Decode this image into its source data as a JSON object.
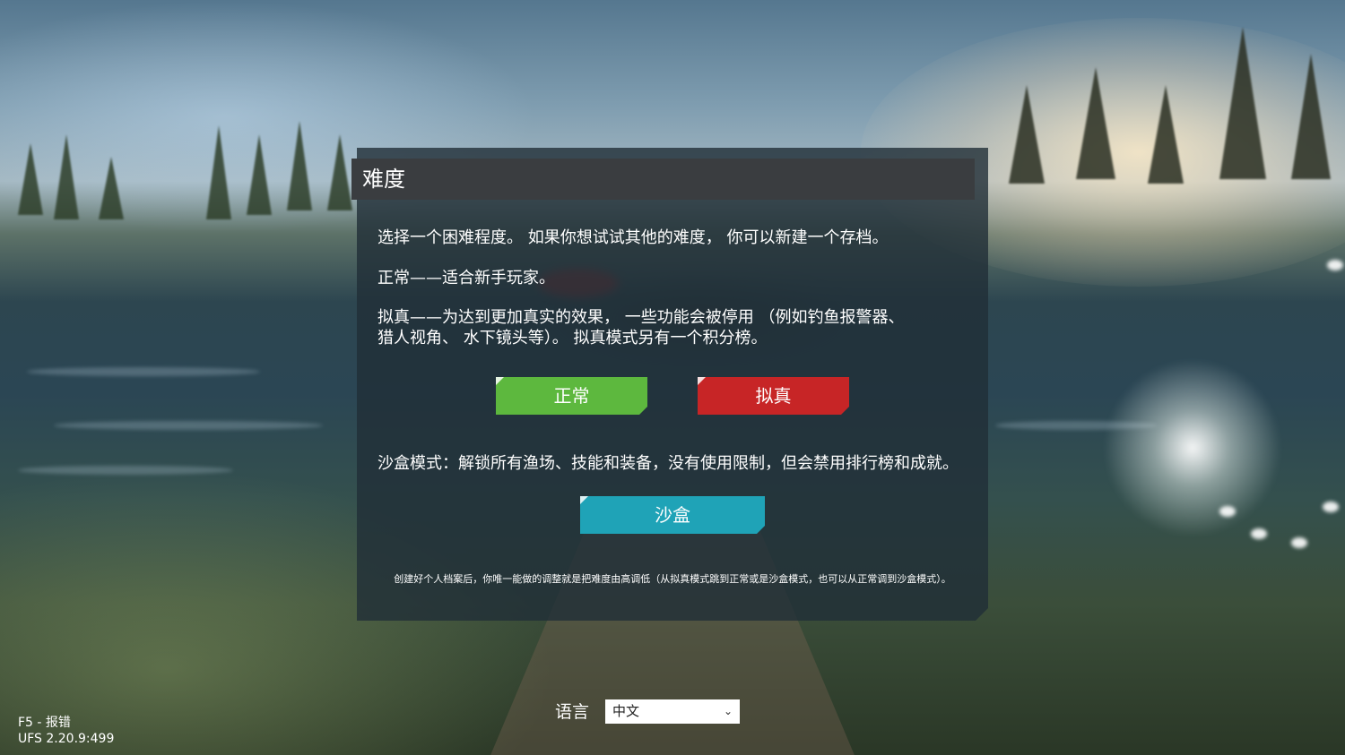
{
  "dialog": {
    "title": "难度",
    "intro": "选择一个困难程度。 如果你想试试其他的难度， 你可以新建一个存档。",
    "normal_desc": "正常——适合新手玩家。",
    "realistic_desc_line1": "拟真——为达到更加真实的效果， 一些功能会被停用 （例如钓鱼报警器、",
    "realistic_desc_line2": "猎人视角、 水下镜头等）。 拟真模式另有一个积分榜。",
    "sandbox_desc": "沙盒模式：解锁所有渔场、技能和装备，没有使用限制，但会禁用排行榜和成就。",
    "footnote": "创建好个人档案后，你唯一能做的调整就是把难度由高调低（从拟真模式跳到正常或是沙盒模式，也可以从正常调到沙盒模式）。",
    "buttons": {
      "normal": "正常",
      "realistic": "拟真",
      "sandbox": "沙盒"
    }
  },
  "language": {
    "label": "语言",
    "selected": "中文"
  },
  "corner": {
    "report_hint": "F5 - 报错",
    "version": "UFS 2.20.9:499"
  },
  "colors": {
    "normal_button": "#5db83e",
    "realistic_button": "#c72526",
    "sandbox_button": "#1fa3b7",
    "dialog_bg": "#212e37",
    "header_bg": "#3a3d40"
  }
}
